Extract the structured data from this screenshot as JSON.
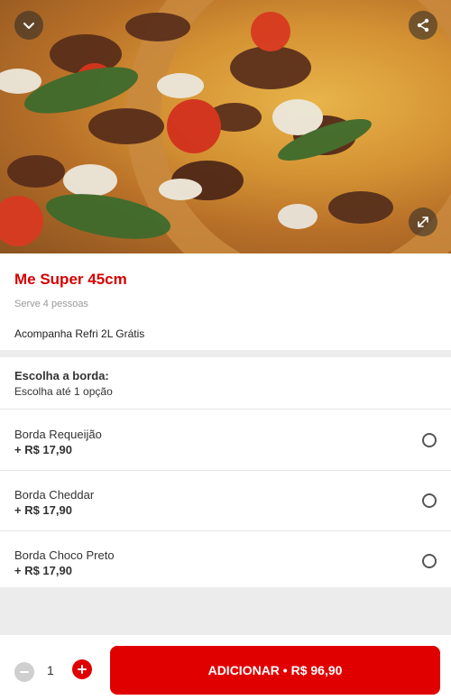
{
  "product": {
    "title": "Me Super 45cm",
    "serves": "Serve 4 pessoas",
    "description": "Acompanha Refri 2L Grátis"
  },
  "hero": {
    "collapse_icon": "chevron-down-icon",
    "share_icon": "share-icon",
    "expand_icon": "expand-icon"
  },
  "crust_group": {
    "title": "Escolha a borda:",
    "subtitle": "Escolha até 1 opção",
    "options": [
      {
        "name": "Borda Requeijão",
        "price": "+ R$ 17,90"
      },
      {
        "name": "Borda Cheddar",
        "price": "+ R$ 17,90"
      },
      {
        "name": "Borda Choco Preto",
        "price": "+ R$ 17,90"
      }
    ]
  },
  "footer": {
    "quantity": "1",
    "add_label": "ADICIONAR • R$ 96,90"
  },
  "colors": {
    "accent": "#e00000",
    "title": "#d60000"
  }
}
